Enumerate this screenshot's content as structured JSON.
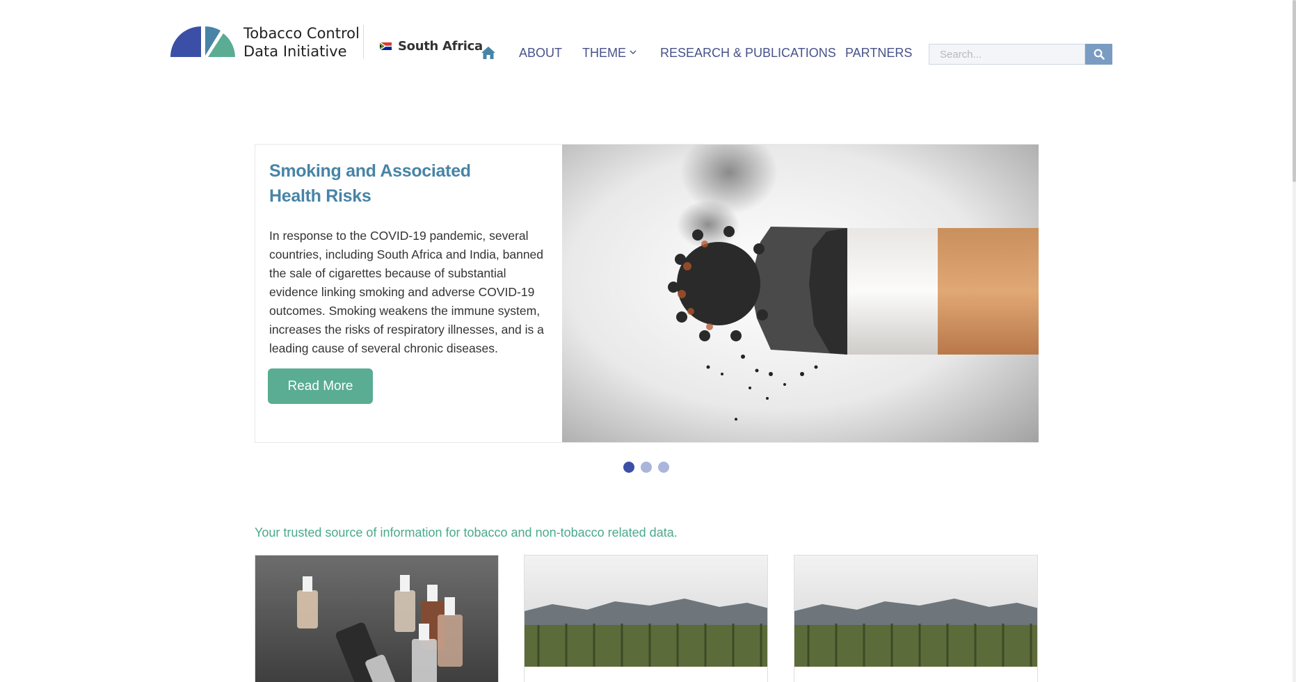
{
  "header": {
    "brand_line1": "Tobacco Control",
    "brand_line2": "Data Initiative",
    "country": "South Africa",
    "logo_colors": {
      "blue": "#3c4fa6",
      "teal": "#4784a6",
      "green": "#5aac93"
    }
  },
  "nav": {
    "home_icon": "home-icon",
    "items": [
      {
        "label": "ABOUT"
      },
      {
        "label": "THEME",
        "has_dropdown": true
      },
      {
        "label": "RESEARCH & PUBLICATIONS"
      },
      {
        "label": "PARTNERS"
      }
    ],
    "color": "#47528a"
  },
  "search": {
    "placeholder": "Search...",
    "value": "",
    "button_icon": "search-icon"
  },
  "carousel": {
    "title": "Smoking and Associated Health Risks",
    "body": "In response to the COVID-19 pandemic, several countries, including South Africa and India, banned the sale of cigarettes because of substantial evidence linking smoking and adverse COVID-19 outcomes. Smoking weakens the immune system, increases the risks of respiratory illnesses, and is a leading cause of several chronic diseases.",
    "button_label": "Read More",
    "slide_count": 3,
    "active_slide": 1,
    "accent": "#4784a6",
    "button_color": "#5aac93"
  },
  "tagline": "Your trusted source of information for tobacco and non-tobacco related data.",
  "cards": [
    {
      "image": "e-cigarette-bottles-image"
    },
    {
      "image": "tobacco-field-image"
    },
    {
      "image": "tobacco-field-image"
    }
  ]
}
